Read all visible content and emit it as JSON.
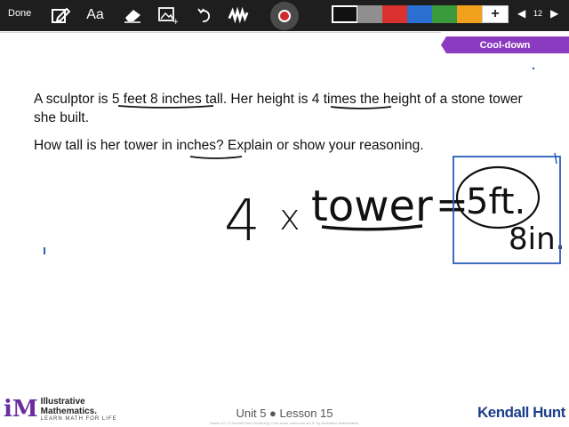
{
  "toolbar": {
    "done_label": "Done",
    "aa_label": "Aa",
    "page_number": "12",
    "icons": [
      "edit-note-icon",
      "text-icon",
      "eraser-icon",
      "image-icon",
      "undo-icon",
      "scribble-icon",
      "record-icon",
      "prev-icon",
      "next-icon"
    ],
    "swatches": [
      "#111111",
      "#8f8f8f",
      "#d9322e",
      "#2b6fd0",
      "#3b9a3b",
      "#f1a11e"
    ],
    "add_label": "+"
  },
  "badge": {
    "label": "Cool-down",
    "color": "#8a3bbf"
  },
  "problem": {
    "line1_a": "A sculptor is ",
    "line1_b": "5 feet 8 inches",
    "line1_c": " tall. Her height is ",
    "line1_d": "4 times",
    "line1_e": " the height of a stone tower she built.",
    "line2_a": "How tall is her tower in ",
    "line2_b": "inches?",
    "line2_c": " Explain or show your reasoning."
  },
  "handwriting": {
    "four": "4",
    "times": "x",
    "tower": "tower",
    "equals": "=",
    "feet": "5ft.",
    "inches": "8in."
  },
  "footer": {
    "logo_mark": "iM",
    "logo_line1": "Illustrative",
    "logo_line2": "Mathematics.",
    "logo_tag": "LEARN MATH FOR LIFE",
    "lesson": "Unit 5 ● Lesson 15",
    "copyright": "Grade 4 IC © Kendall Hunt Publishing. Cool-down resources are IC by Illustrative Mathematics.",
    "publisher": "Kendall Hunt"
  }
}
